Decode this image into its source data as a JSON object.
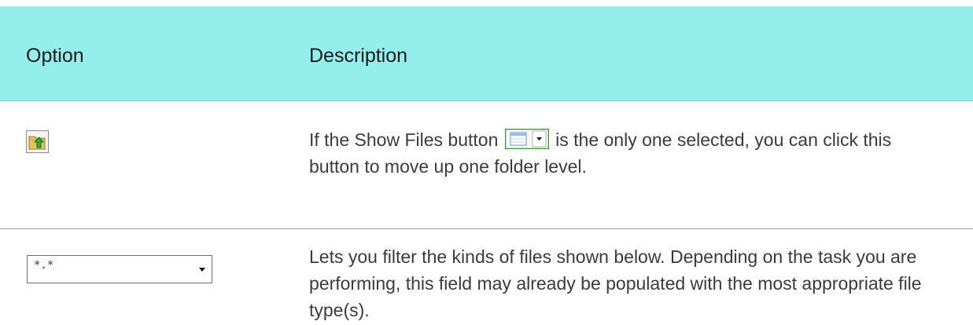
{
  "table": {
    "headers": {
      "option": "Option",
      "description": "Description"
    },
    "rows": [
      {
        "option_icon": "folder-up-icon",
        "description_part1": "If the Show Files button",
        "inline_icon": "show-files-button-icon",
        "description_part2": "is the only one selected, you can click this button to move up one folder level."
      },
      {
        "option_control": {
          "value": "*.*",
          "icon": "chevron-down-icon"
        },
        "description": "Lets you filter the kinds of files shown below. Depending on the task you are performing, this field may already be populated with the most appropriate file type(s)."
      }
    ]
  },
  "colors": {
    "header_bg": "#94efec",
    "divider": "#9b9b9b"
  }
}
